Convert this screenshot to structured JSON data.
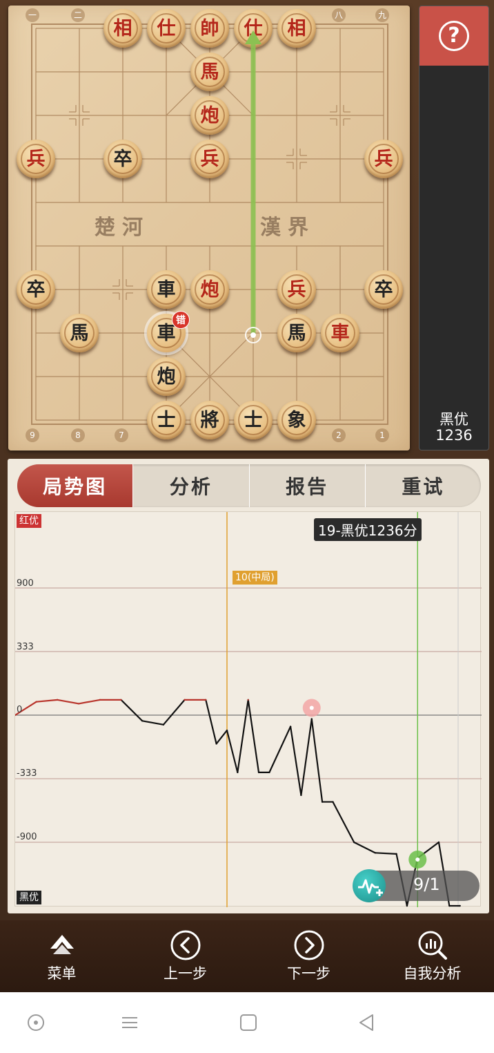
{
  "board": {
    "file_numbers_top": [
      "一",
      "二",
      "八",
      "九"
    ],
    "file_numbers_bottom": [
      "9",
      "8",
      "7",
      "2",
      "1"
    ],
    "river_left": "楚河",
    "river_right": "漢界",
    "error_badge": "错",
    "pieces": [
      {
        "char": "相",
        "side": "red"
      },
      {
        "char": "仕",
        "side": "red"
      },
      {
        "char": "帥",
        "side": "red"
      },
      {
        "char": "仕",
        "side": "red"
      },
      {
        "char": "相",
        "side": "red"
      },
      {
        "char": "馬",
        "side": "red"
      },
      {
        "char": "炮",
        "side": "red"
      },
      {
        "char": "兵",
        "side": "red"
      },
      {
        "char": "卒",
        "side": "black"
      },
      {
        "char": "兵",
        "side": "red"
      },
      {
        "char": "兵",
        "side": "red"
      },
      {
        "char": "卒",
        "side": "black"
      },
      {
        "char": "車",
        "side": "black"
      },
      {
        "char": "炮",
        "side": "red"
      },
      {
        "char": "兵",
        "side": "red"
      },
      {
        "char": "卒",
        "side": "black"
      },
      {
        "char": "馬",
        "side": "black"
      },
      {
        "char": "車",
        "side": "black"
      },
      {
        "char": "馬",
        "side": "black"
      },
      {
        "char": "車",
        "side": "red"
      },
      {
        "char": "炮",
        "side": "black"
      },
      {
        "char": "士",
        "side": "black"
      },
      {
        "char": "將",
        "side": "black"
      },
      {
        "char": "士",
        "side": "black"
      },
      {
        "char": "象",
        "side": "black"
      }
    ]
  },
  "side_panel": {
    "help_icon": "?",
    "eval_side": "黑优",
    "eval_score": "1236"
  },
  "tabs": [
    "局势图",
    "分析",
    "报告",
    "重试"
  ],
  "chart_data": {
    "type": "line",
    "top_tag": "红优",
    "bottom_tag": "黑优",
    "y_ticks": [
      "900",
      "333",
      "0",
      "-333",
      "-900"
    ],
    "phase_marker": {
      "label": "10(中局)",
      "move": 10
    },
    "tooltip": "19-黑优1236分",
    "pager": "9/1",
    "scale_note": "non-linear advantage scale; y values in score points",
    "points": [
      {
        "move": 0,
        "y": 0
      },
      {
        "move": 1,
        "y": 70
      },
      {
        "move": 2,
        "y": 80
      },
      {
        "move": 3,
        "y": 60
      },
      {
        "move": 4,
        "y": 80
      },
      {
        "move": 5,
        "y": 80
      },
      {
        "move": 6,
        "y": -30
      },
      {
        "move": 7,
        "y": -50
      },
      {
        "move": 8,
        "y": 80
      },
      {
        "move": 9,
        "y": 80
      },
      {
        "move": 9.5,
        "y": -150
      },
      {
        "move": 10,
        "y": -80
      },
      {
        "move": 10.5,
        "y": -300
      },
      {
        "move": 11,
        "y": 80
      },
      {
        "move": 11.5,
        "y": -300
      },
      {
        "move": 12,
        "y": -300
      },
      {
        "move": 13,
        "y": -60
      },
      {
        "move": 13.5,
        "y": -480
      },
      {
        "move": 14,
        "y": -20
      },
      {
        "move": 14.5,
        "y": -540
      },
      {
        "move": 15,
        "y": -540
      },
      {
        "move": 16,
        "y": -900
      },
      {
        "move": 17,
        "y": -1000
      },
      {
        "move": 18,
        "y": -1010
      },
      {
        "move": 18.5,
        "y": -1500
      },
      {
        "move": 19,
        "y": -1050
      },
      {
        "move": 20,
        "y": -900
      },
      {
        "move": 20.5,
        "y": -1500
      },
      {
        "move": 21,
        "y": -1500
      }
    ]
  },
  "nav": [
    {
      "label": "菜单",
      "icon": "menu-icon"
    },
    {
      "label": "上一步",
      "icon": "prev-icon"
    },
    {
      "label": "下一步",
      "icon": "next-icon"
    },
    {
      "label": "自我分析",
      "icon": "analysis-icon"
    }
  ],
  "colors": {
    "accent_red": "#c3564b",
    "move_arrow": "#8cc152",
    "phase_line": "#e0a030",
    "current_line": "#6cc04a"
  }
}
